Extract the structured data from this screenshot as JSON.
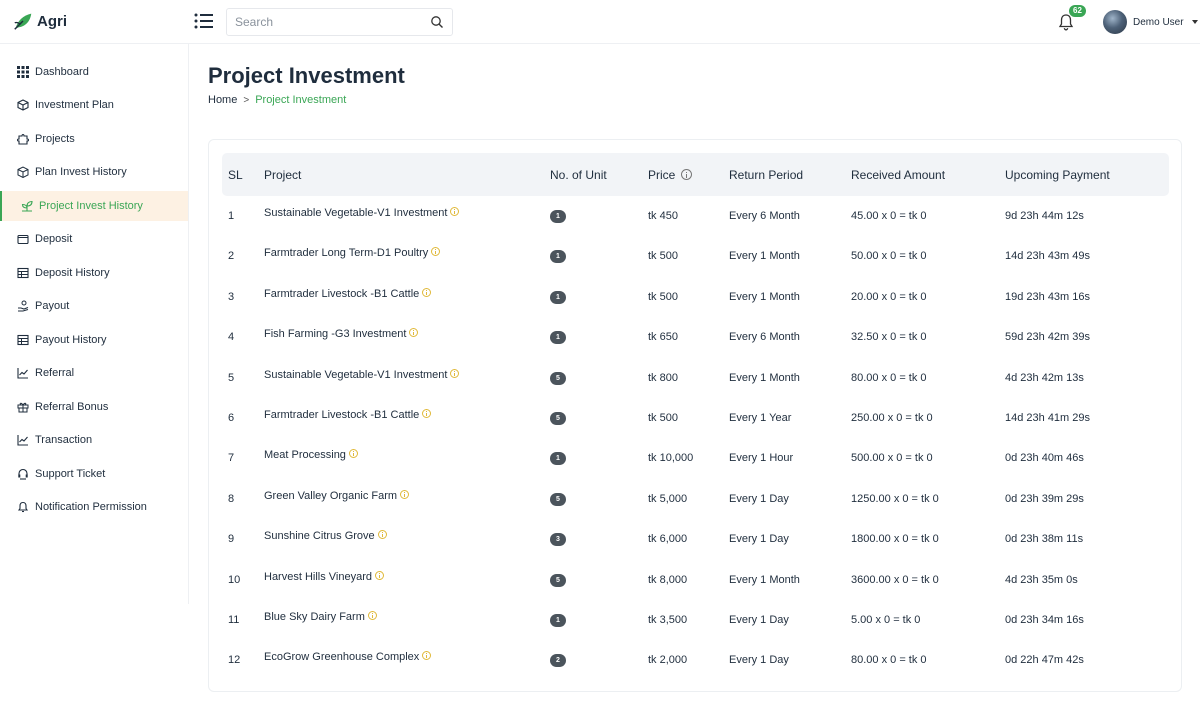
{
  "app": {
    "logo_text": "Agri"
  },
  "search": {
    "placeholder": "Search"
  },
  "notifications": {
    "count": "62"
  },
  "user": {
    "name": "Demo User"
  },
  "sidebar": {
    "items": [
      {
        "label": "Dashboard",
        "icon": "grid-icon"
      },
      {
        "label": "Investment Plan",
        "icon": "cube-icon"
      },
      {
        "label": "Projects",
        "icon": "puzzle-icon"
      },
      {
        "label": "Plan Invest History",
        "icon": "box-icon"
      },
      {
        "label": "Project Invest History",
        "icon": "plant-icon",
        "active": true
      },
      {
        "label": "Deposit",
        "icon": "wallet-icon"
      },
      {
        "label": "Deposit History",
        "icon": "table-icon"
      },
      {
        "label": "Payout",
        "icon": "hand-coin-icon"
      },
      {
        "label": "Payout History",
        "icon": "table-icon"
      },
      {
        "label": "Referral",
        "icon": "chart-line-icon"
      },
      {
        "label": "Referral Bonus",
        "icon": "gift-icon"
      },
      {
        "label": "Transaction",
        "icon": "chart-line-icon"
      },
      {
        "label": "Support Ticket",
        "icon": "headset-icon"
      },
      {
        "label": "Notification Permission",
        "icon": "bell-icon"
      }
    ]
  },
  "page": {
    "title": "Project Investment",
    "breadcrumb": {
      "home": "Home",
      "separator": ">",
      "current": "Project Investment"
    }
  },
  "table": {
    "headers": {
      "sl": "SL",
      "project": "Project",
      "units": "No. of Unit",
      "price": "Price",
      "return_period": "Return Period",
      "received": "Received Amount",
      "upcoming": "Upcoming Payment"
    },
    "rows": [
      {
        "sl": "1",
        "project": "Sustainable Vegetable-V1 Investment",
        "units": "1",
        "price": "tk 450",
        "period": "Every 6 Month",
        "received": "45.00 x 0 = tk 0",
        "upcoming": "9d 23h 44m 12s"
      },
      {
        "sl": "2",
        "project": "Farmtrader Long Term-D1 Poultry",
        "units": "1",
        "price": "tk 500",
        "period": "Every 1 Month",
        "received": "50.00 x 0 = tk 0",
        "upcoming": "14d 23h 43m 49s"
      },
      {
        "sl": "3",
        "project": "Farmtrader Livestock -B1 Cattle",
        "units": "1",
        "price": "tk 500",
        "period": "Every 1 Month",
        "received": "20.00 x 0 = tk 0",
        "upcoming": "19d 23h 43m 16s"
      },
      {
        "sl": "4",
        "project": "Fish Farming -G3 Investment",
        "units": "1",
        "price": "tk 650",
        "period": "Every 6 Month",
        "received": "32.50 x 0 = tk 0",
        "upcoming": "59d 23h 42m 39s"
      },
      {
        "sl": "5",
        "project": "Sustainable Vegetable-V1 Investment",
        "units": "5",
        "price": "tk 800",
        "period": "Every 1 Month",
        "received": "80.00 x 0 = tk 0",
        "upcoming": "4d 23h 42m 13s"
      },
      {
        "sl": "6",
        "project": "Farmtrader Livestock -B1 Cattle",
        "units": "5",
        "price": "tk 500",
        "period": "Every 1 Year",
        "received": "250.00 x 0 = tk 0",
        "upcoming": "14d 23h 41m 29s"
      },
      {
        "sl": "7",
        "project": "Meat Processing",
        "units": "1",
        "price": "tk 10,000",
        "period": "Every 1 Hour",
        "received": "500.00 x 0 = tk 0",
        "upcoming": "0d 23h 40m 46s"
      },
      {
        "sl": "8",
        "project": "Green Valley Organic Farm",
        "units": "5",
        "price": "tk 5,000",
        "period": "Every 1 Day",
        "received": "1250.00 x 0 = tk 0",
        "upcoming": "0d 23h 39m 29s"
      },
      {
        "sl": "9",
        "project": "Sunshine Citrus Grove",
        "units": "3",
        "price": "tk 6,000",
        "period": "Every 1 Day",
        "received": "1800.00 x 0 = tk 0",
        "upcoming": "0d 23h 38m 11s"
      },
      {
        "sl": "10",
        "project": "Harvest Hills Vineyard",
        "units": "5",
        "price": "tk 8,000",
        "period": "Every 1 Month",
        "received": "3600.00 x 0 = tk 0",
        "upcoming": "4d 23h 35m 0s"
      },
      {
        "sl": "11",
        "project": "Blue Sky Dairy Farm",
        "units": "1",
        "price": "tk 3,500",
        "period": "Every 1 Day",
        "received": "5.00 x 0 = tk 0",
        "upcoming": "0d 23h 34m 16s"
      },
      {
        "sl": "12",
        "project": "EcoGrow Greenhouse Complex",
        "units": "2",
        "price": "tk 2,000",
        "period": "Every 1 Day",
        "received": "80.00 x 0 = tk 0",
        "upcoming": "0d 22h 47m 42s"
      }
    ]
  },
  "colors": {
    "accent": "#3aa655",
    "active_bg": "#fdf1e3",
    "header_bg": "#f2f4f7",
    "unit_badge": "#4b545c",
    "info_icon": "#e0b93a"
  }
}
